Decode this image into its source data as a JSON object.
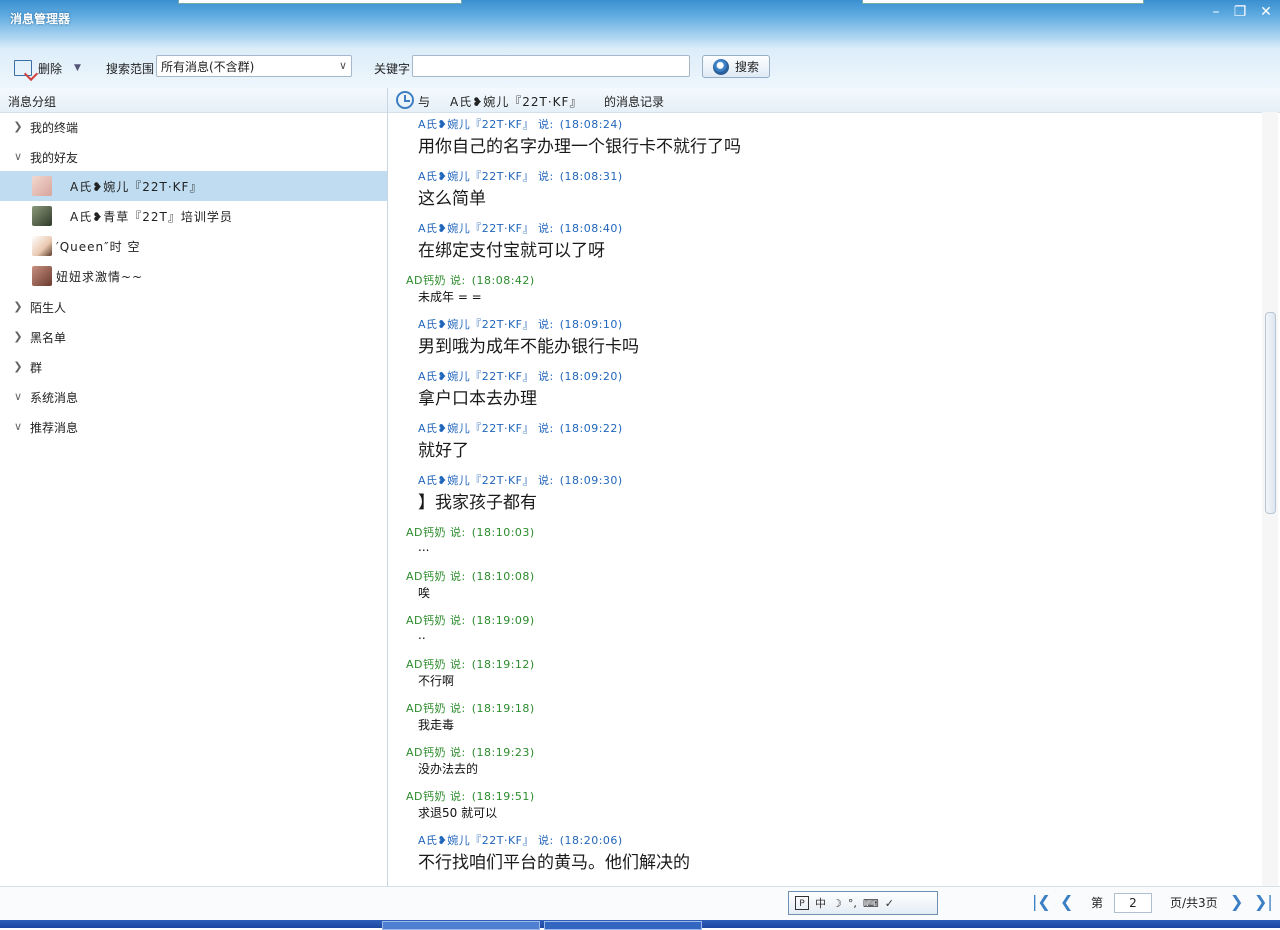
{
  "window": {
    "title": "消息管理器"
  },
  "toolbar": {
    "delete_label": "删除",
    "range_label": "搜索范围",
    "range_value": "所有消息(不含群)",
    "keyword_label": "关键字",
    "keyword_value": "",
    "search_label": "搜索"
  },
  "left": {
    "header": "消息分组",
    "groups": [
      {
        "label": "我的终端",
        "expanded": false
      },
      {
        "label": "我的好友",
        "expanded": true
      },
      {
        "label": "陌生人",
        "expanded": false
      },
      {
        "label": "黑名单",
        "expanded": false
      },
      {
        "label": "群",
        "expanded": false
      },
      {
        "label": "系统消息",
        "expanded": true
      },
      {
        "label": "推荐消息",
        "expanded": true
      }
    ],
    "friends": [
      {
        "name": "A氏❥婉儿『22T·KF』",
        "selected": true
      },
      {
        "name": "A氏❥青草『22T』培训学员",
        "selected": false
      },
      {
        "name": "′Queen″时 空",
        "selected": false
      },
      {
        "name": "妞妞求激情~~",
        "selected": false
      }
    ]
  },
  "right": {
    "header_prefix": "与",
    "header_name": "A氏❥婉儿『22T·KF』",
    "header_suffix": "的消息记录",
    "messages": [
      {
        "sender": "A氏❥婉儿『22T·KF』 说:",
        "time": "(18:08:24)",
        "text": "用你自己的名字办理一个银行卡不就行了吗",
        "style": "big"
      },
      {
        "sender": "A氏❥婉儿『22T·KF』 说:",
        "time": "(18:08:31)",
        "text": "这么简单",
        "style": "big"
      },
      {
        "sender": "A氏❥婉儿『22T·KF』 说:",
        "time": "(18:08:40)",
        "text": "在绑定支付宝就可以了呀",
        "style": "big"
      },
      {
        "sender": "AD钙奶 说:",
        "time": "(18:08:42)",
        "text": "未成年 = =",
        "style": "small"
      },
      {
        "sender": "A氏❥婉儿『22T·KF』 说:",
        "time": "(18:09:10)",
        "text": "男到哦为成年不能办银行卡吗",
        "style": "big"
      },
      {
        "sender": "A氏❥婉儿『22T·KF』 说:",
        "time": "(18:09:20)",
        "text": "拿户口本去办理",
        "style": "big"
      },
      {
        "sender": "A氏❥婉儿『22T·KF』 说:",
        "time": "(18:09:22)",
        "text": "就好了",
        "style": "big"
      },
      {
        "sender": "A氏❥婉儿『22T·KF』 说:",
        "time": "(18:09:30)",
        "text": "】我家孩子都有",
        "style": "big"
      },
      {
        "sender": "AD钙奶 说:",
        "time": "(18:10:03)",
        "text": "...",
        "style": "small"
      },
      {
        "sender": "AD钙奶 说:",
        "time": "(18:10:08)",
        "text": "唉",
        "style": "small"
      },
      {
        "sender": "AD钙奶 说:",
        "time": "(18:19:09)",
        "text": "..",
        "style": "small"
      },
      {
        "sender": "AD钙奶 说:",
        "time": "(18:19:12)",
        "text": "不行啊",
        "style": "small"
      },
      {
        "sender": "AD钙奶 说:",
        "time": "(18:19:18)",
        "text": "我走毒",
        "style": "small"
      },
      {
        "sender": "AD钙奶 说:",
        "time": "(18:19:23)",
        "text": "没办法去的",
        "style": "small"
      },
      {
        "sender": "AD钙奶 说:",
        "time": "(18:19:51)",
        "text": "求退50  就可以",
        "style": "small"
      },
      {
        "sender": "A氏❥婉儿『22T·KF』 说:",
        "time": "(18:20:06)",
        "text": "不行找咱们平台的黄马。他们解决的",
        "style": "big"
      }
    ]
  },
  "bottom": {
    "ime": [
      "中",
      "☽",
      "°,",
      "⌨",
      "✓"
    ],
    "page_prefix": "第",
    "page_current": "2",
    "page_suffix": "页/共3页"
  },
  "colors": {
    "title_bar": "#3a8fd0",
    "selected_row": "#bfdcf0",
    "sender_blue": "#2266bb",
    "sender_green": "#2c8c2c"
  }
}
